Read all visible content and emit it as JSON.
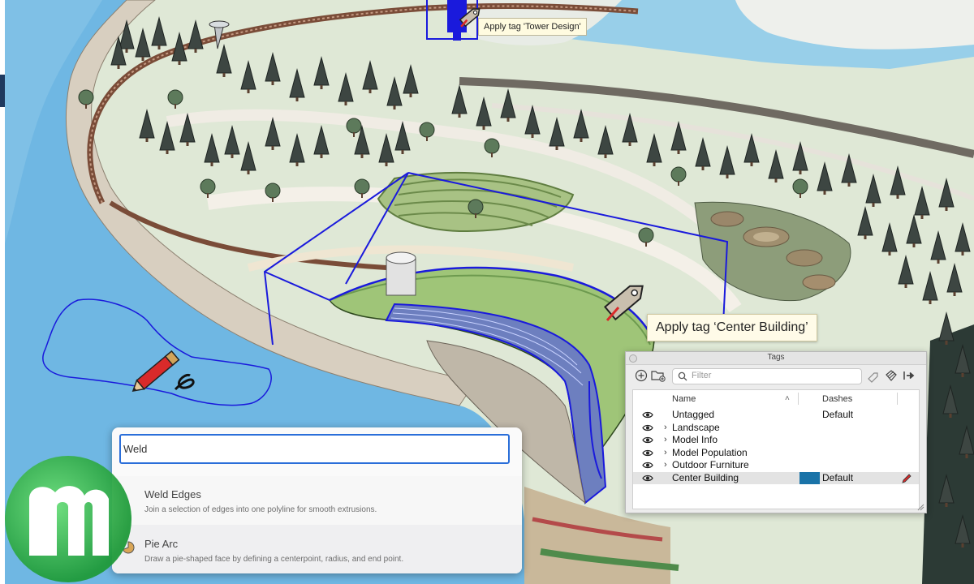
{
  "tooltips": {
    "tower": "Apply tag 'Tower Design'",
    "center": "Apply tag ‘Center Building’"
  },
  "search": {
    "query": "Weld",
    "results": [
      {
        "title": "Weld Edges",
        "description": "Join a selection of edges into one polyline for smooth extrusions."
      },
      {
        "title": "Pie Arc",
        "description": "Draw a pie-shaped face by defining a centerpoint, radius, and end point."
      }
    ]
  },
  "tags_panel": {
    "title": "Tags",
    "filter_placeholder": "Filter",
    "columns": {
      "name": "Name",
      "dashes": "Dashes"
    },
    "rows": [
      {
        "name": "Untagged",
        "dashes": "Default",
        "expandable": false,
        "selected": false
      },
      {
        "name": "Landscape",
        "dashes": "",
        "expandable": true,
        "selected": false
      },
      {
        "name": "Model Info",
        "dashes": "",
        "expandable": true,
        "selected": false
      },
      {
        "name": "Model Population",
        "dashes": "",
        "expandable": true,
        "selected": false
      },
      {
        "name": "Outdoor Furniture",
        "dashes": "",
        "expandable": true,
        "selected": false
      },
      {
        "name": "Center Building",
        "dashes": "Default",
        "expandable": false,
        "selected": true,
        "color": "#1a73a8"
      }
    ],
    "expand_glyph": "›",
    "sort_glyph": "˄"
  },
  "colors": {
    "selection_blue": "#1a1adc",
    "water": "#6fb7e3",
    "ground": "#dfe8d6",
    "accent": "#2a6ed9"
  },
  "icons": [
    "eye-icon",
    "add-tag-icon",
    "add-folder-icon",
    "search-icon",
    "tag-tool-icon",
    "dash-icon",
    "export-icon",
    "pencil-icon",
    "pie-icon",
    "tag-cursor-icon",
    "logo-icon"
  ]
}
